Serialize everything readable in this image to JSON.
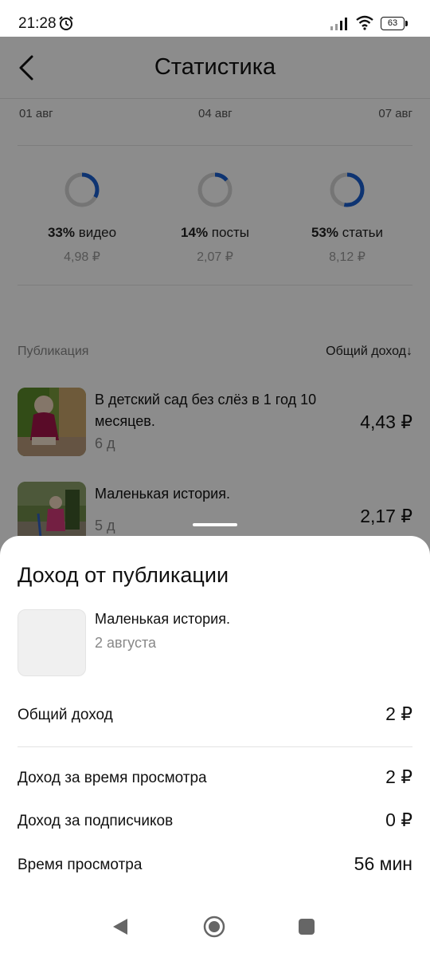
{
  "status_bar": {
    "time": "21:28",
    "battery": "63",
    "icons": [
      "alarm-icon",
      "signal-icon",
      "wifi-icon",
      "battery-icon"
    ]
  },
  "header": {
    "title": "Статистика",
    "back_icon": "chevron-left-icon"
  },
  "chart_axis_dates": [
    "01 авг",
    "04 авг",
    "07 авг"
  ],
  "breakdown": [
    {
      "percent": "33%",
      "label": "видео",
      "amount": "4,98 ₽",
      "share": 0.33
    },
    {
      "percent": "14%",
      "label": "посты",
      "amount": "2,07 ₽",
      "share": 0.14
    },
    {
      "percent": "53%",
      "label": "статьи",
      "amount": "8,12 ₽",
      "share": 0.53
    }
  ],
  "publications": {
    "column_label": "Публикация",
    "sort_label": "Общий доход↓",
    "items": [
      {
        "title": "В детский сад без слёз в 1 год 10 месяцев.",
        "age": "6 д",
        "income": "4,43 ₽"
      },
      {
        "title": "Маленькая история.",
        "age": "5 д",
        "income": "2,17 ₽"
      }
    ]
  },
  "sheet": {
    "title": "Доход от публикации",
    "publication_title": "Маленькая история.",
    "publication_date": "2 августа",
    "rows": [
      {
        "label": "Общий доход",
        "value": "2 ₽"
      },
      {
        "label": "Доход за время просмотра",
        "value": "2 ₽"
      },
      {
        "label": "Доход за подписчиков",
        "value": "0 ₽"
      },
      {
        "label": "Время просмотра",
        "value": "56 мин"
      }
    ]
  },
  "nav_bar": {
    "icons": [
      "back-triangle-icon",
      "home-circle-icon",
      "recents-square-icon"
    ]
  },
  "colors": {
    "accent": "#1a5fd0",
    "ring_track": "#d6d6d6",
    "scrim": "#737373"
  }
}
